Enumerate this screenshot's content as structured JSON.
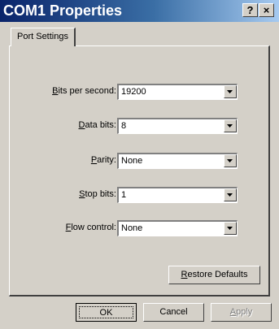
{
  "window": {
    "title": "COM1 Properties",
    "help_button": "?",
    "close_button": "×"
  },
  "tabs": [
    {
      "label": "Port Settings",
      "selected": true
    }
  ],
  "settings": [
    {
      "label_prefix": "",
      "label_accel": "B",
      "label_rest": "its per second:",
      "value": "19200"
    },
    {
      "label_prefix": "",
      "label_accel": "D",
      "label_rest": "ata bits:",
      "value": "8"
    },
    {
      "label_prefix": "",
      "label_accel": "P",
      "label_rest": "arity:",
      "value": "None"
    },
    {
      "label_prefix": "",
      "label_accel": "S",
      "label_rest": "top bits:",
      "value": "1"
    },
    {
      "label_prefix": "",
      "label_accel": "F",
      "label_rest": "low control:",
      "value": "None"
    }
  ],
  "restore": {
    "accel": "R",
    "rest": "estore Defaults"
  },
  "buttons": {
    "ok": "OK",
    "cancel": "Cancel",
    "apply_accel": "A",
    "apply_rest": "pply"
  },
  "colors": {
    "title_gradient_start": "#0a246a",
    "title_gradient_end": "#a6caf0",
    "face": "#d4d0c8"
  }
}
